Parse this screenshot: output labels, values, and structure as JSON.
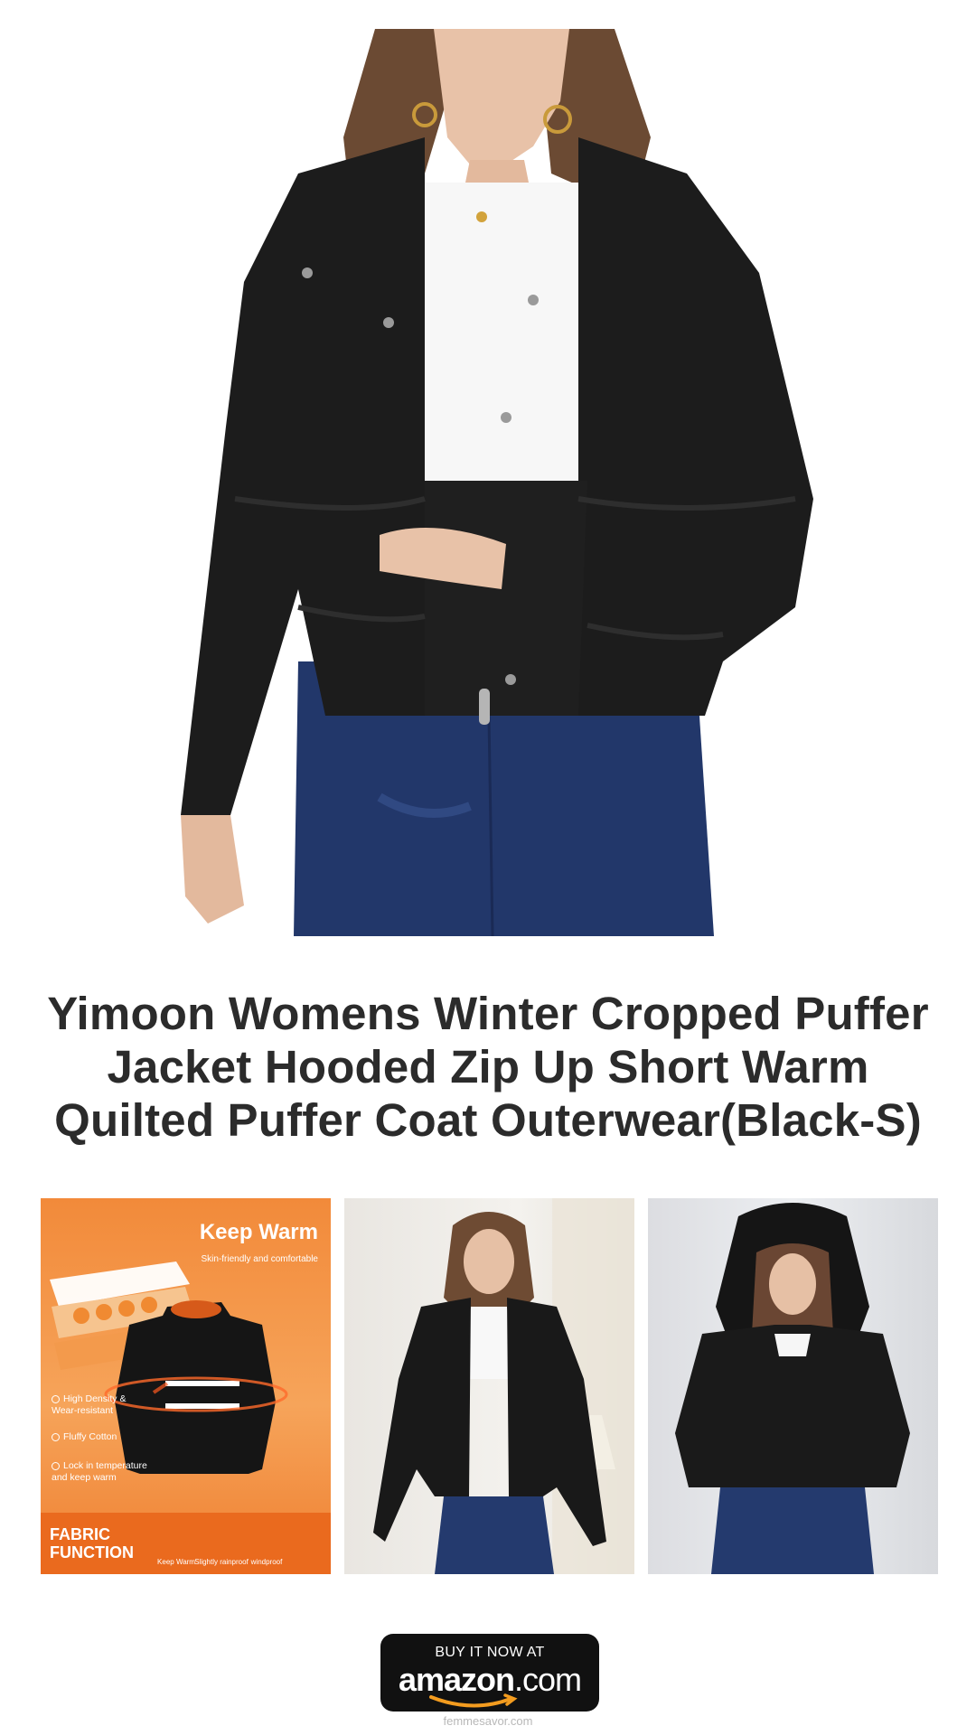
{
  "hero": {
    "alt": "Woman wearing black cropped puffer jacket with white top and blue jeans"
  },
  "product": {
    "title_lines": [
      "Yimoon Womens Winter Cropped Puffer",
      "Jacket Hooded Zip Up Short Warm",
      "Quilted Puffer Coat Outerwear(Black-S)"
    ]
  },
  "thumbnails": [
    {
      "kind": "fabric-function-card",
      "headline": "Keep Warm",
      "subhead": "Skin-friendly and comfortable",
      "features": [
        "High Density & Wear-resistant",
        "Fluffy Cotton",
        "Lock in temperature and keep warm"
      ],
      "banner_lines": [
        "FABRIC",
        "FUNCTION"
      ],
      "icon_captions": [
        "Keep Warm",
        "Slightly rainproof",
        "windproof"
      ],
      "accent_color": "#ef7f30"
    },
    {
      "kind": "photo",
      "alt": "Model front view open jacket"
    },
    {
      "kind": "photo",
      "alt": "Model wearing hood up"
    }
  ],
  "cta": {
    "top_label": "BUY IT NOW AT",
    "brand": "amazon",
    "brand_suffix": ".com"
  },
  "footer": {
    "site": "femmesavor.com"
  }
}
